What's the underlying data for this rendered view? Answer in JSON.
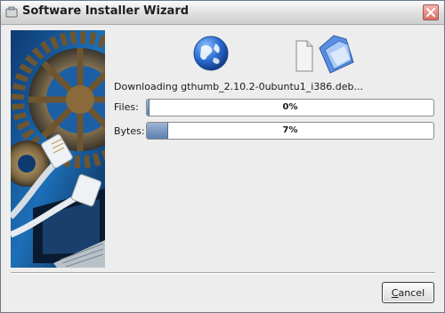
{
  "window": {
    "title": "Software Installer Wizard",
    "title_icon": "installer-app-icon",
    "close_icon": "close-icon"
  },
  "banner": {
    "image": "gears-network-cables-illustration"
  },
  "icons": {
    "left": "globe-icon",
    "right": "documents-folder-icon"
  },
  "status": "Downloading gthumb_2.10.2-0ubuntu1_i386.deb...",
  "progress": [
    {
      "label": "Files:",
      "percent_text": "0%",
      "value": 0.0
    },
    {
      "label": "Bytes:",
      "percent_text": "7%",
      "value": 0.07
    }
  ],
  "buttons": {
    "cancel_mnemonic": "C",
    "cancel_rest": "ancel"
  },
  "colors": {
    "progress_fill": "#5c7fb0",
    "close_button": "#d76f66",
    "accent_blue": "#2a6bd0"
  }
}
